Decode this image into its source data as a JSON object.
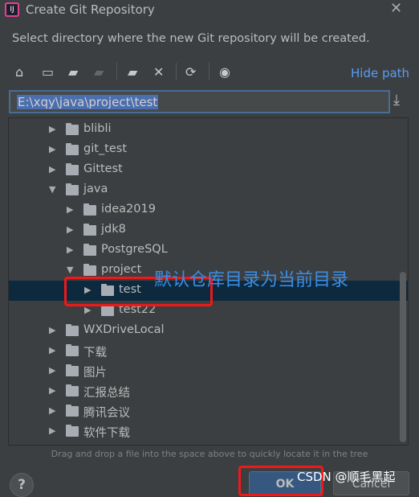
{
  "window": {
    "title": "Create Git Repository",
    "close_icon": "close-icon"
  },
  "description": "Select directory where the new Git repository will be created.",
  "toolbar": {
    "icons": [
      "home-icon",
      "desktop-icon",
      "project-folder-icon",
      "module-folder-icon",
      "new-folder-icon",
      "delete-icon",
      "refresh-icon",
      "show-hidden-icon"
    ],
    "hide_path": "Hide path"
  },
  "path": {
    "value": "E:\\xqy\\java\\project\\test"
  },
  "tree": {
    "items": [
      {
        "label": "blibli",
        "level": 0,
        "expanded": false
      },
      {
        "label": "git_test",
        "level": 0,
        "expanded": false
      },
      {
        "label": "Gittest",
        "level": 0,
        "expanded": false
      },
      {
        "label": "java",
        "level": 0,
        "expanded": true
      },
      {
        "label": "idea2019",
        "level": 1,
        "expanded": false
      },
      {
        "label": "jdk8",
        "level": 1,
        "expanded": false
      },
      {
        "label": "PostgreSQL",
        "level": 1,
        "expanded": false
      },
      {
        "label": "project",
        "level": 1,
        "expanded": true
      },
      {
        "label": "test",
        "level": 2,
        "expanded": false,
        "selected": true
      },
      {
        "label": "test22",
        "level": 2,
        "expanded": false
      },
      {
        "label": "WXDriveLocal",
        "level": 0,
        "expanded": false
      },
      {
        "label": "下载",
        "level": 0,
        "expanded": false
      },
      {
        "label": "图片",
        "level": 0,
        "expanded": false
      },
      {
        "label": "汇报总结",
        "level": 0,
        "expanded": false
      },
      {
        "label": "腾讯会议",
        "level": 0,
        "expanded": false
      },
      {
        "label": "软件下载",
        "level": 0,
        "expanded": false
      }
    ]
  },
  "hint": "Drag and drop a file into the space above to quickly locate it in the tree",
  "buttons": {
    "help": "?",
    "ok": "OK",
    "cancel": "Cancel"
  },
  "annotation": {
    "note": "默认仓库目录为当前目录",
    "color": "#3a8ee6",
    "box_color": "#f01818"
  },
  "watermark": "CSDN @顺毛黑起"
}
